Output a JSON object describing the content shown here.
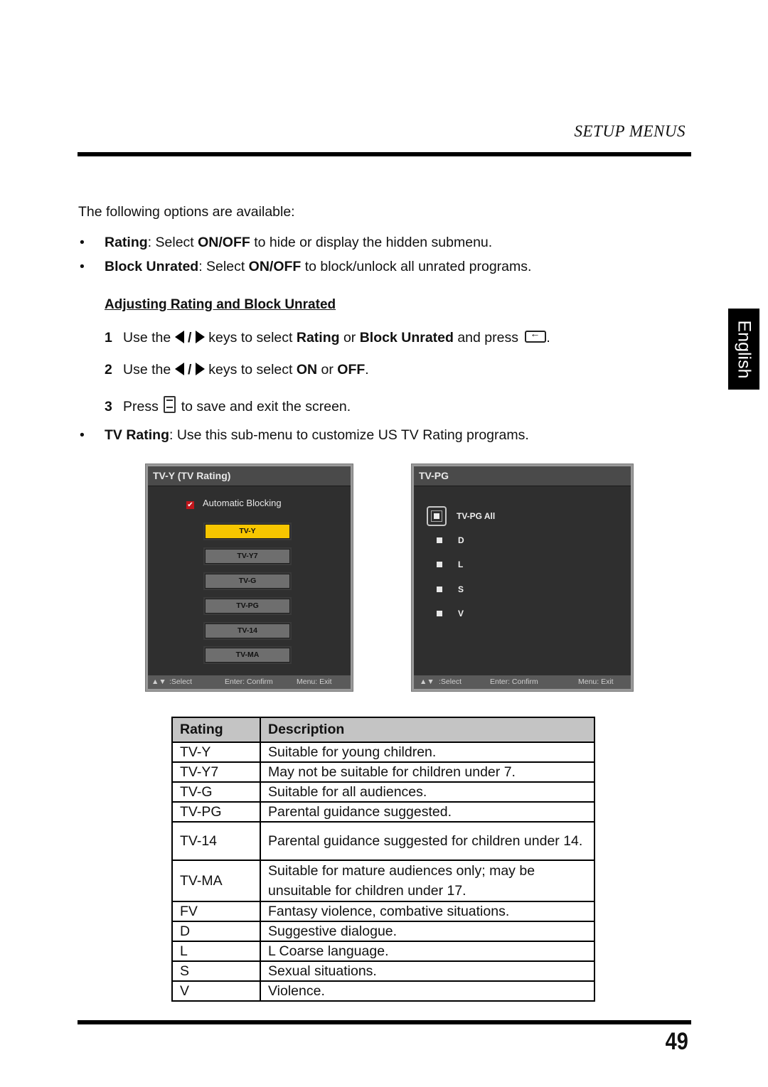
{
  "header": {
    "section_title": "SETUP MENUS"
  },
  "language_tab": "English",
  "intro": "The following options are available:",
  "bullets": [
    {
      "term": "Rating",
      "text_a": ": Select ",
      "bold_b": "ON/OFF",
      "text_c": " to hide or display the hidden submenu."
    },
    {
      "term": "Block Unrated",
      "text_a": ": Select ",
      "bold_b": "ON/OFF",
      "text_c": " to block/unlock all unrated programs."
    }
  ],
  "subheading": "Adjusting Rating and Block Unrated",
  "steps": [
    {
      "num": "1",
      "pre": "Use the",
      "slash": "/",
      "mid": " keys to select ",
      "b1": "Rating",
      "or": " or ",
      "b2": "Block Unrated",
      "post": " and press",
      "end": "."
    },
    {
      "num": "2",
      "pre": "Use the",
      "slash": "/",
      "mid": " keys to select ",
      "b1": "ON",
      "or": " or ",
      "b2": "OFF",
      "end": "."
    },
    {
      "num": "3",
      "pre": "Press",
      "post": " to save and exit the screen."
    }
  ],
  "tv_rating_bullet": {
    "term": "TV Rating",
    "text": ": Use this sub-menu to customize US TV Rating programs."
  },
  "osd_left": {
    "title": "TV-Y (TV Rating)",
    "auto_blocking": "Automatic Blocking",
    "auto_blocking_checked": true,
    "buttons": [
      "TV-Y",
      "TV-Y7",
      "TV-G",
      "TV-PG",
      "TV-14",
      "TV-MA"
    ],
    "selected": "TV-Y",
    "footer": {
      "select": ":Select",
      "confirm": "Enter: Confirm",
      "exit": "Menu: Exit"
    },
    "colors": {
      "selected": "#f7c600",
      "button": "#6e6e6e",
      "background": "#2f2f2f"
    }
  },
  "osd_right": {
    "title": "TV-PG",
    "items": [
      "TV-PG All",
      "D",
      "L",
      "S",
      "V"
    ],
    "footer": {
      "select": ":Select",
      "confirm": "Enter: Confirm",
      "exit": "Menu: Exit"
    }
  },
  "table": {
    "headers": [
      "Rating",
      "Description"
    ],
    "rows": [
      {
        "rating": "TV-Y",
        "desc": "Suitable for young children."
      },
      {
        "rating": "TV-Y7",
        "desc": "May not be suitable for children under 7."
      },
      {
        "rating": "TV-G",
        "desc": "Suitable for all audiences."
      },
      {
        "rating": "TV-PG",
        "desc": "Parental guidance suggested."
      },
      {
        "rating": "TV-14",
        "desc": "Parental guidance suggested for children under 14."
      },
      {
        "rating": "TV-MA",
        "desc": "Suitable for mature audiences only; may be unsuitable for children under 17."
      },
      {
        "rating": "FV",
        "desc": "Fantasy violence, combative situations."
      },
      {
        "rating": "D",
        "desc": "Suggestive dialogue."
      },
      {
        "rating": "L",
        "desc": "L Coarse language."
      },
      {
        "rating": "S",
        "desc": "Sexual situations."
      },
      {
        "rating": "V",
        "desc": "Violence."
      }
    ]
  },
  "page_number": "49"
}
